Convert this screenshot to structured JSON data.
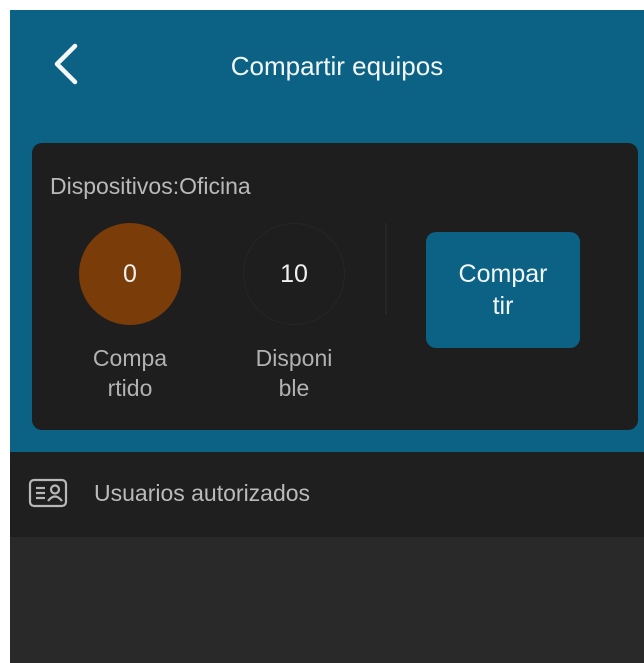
{
  "header": {
    "title": "Compartir equipos",
    "back_icon": "chevron-left-icon"
  },
  "device_card": {
    "title": "Dispositivos:Oficina",
    "shared": {
      "count": "0",
      "label": "Compa\nrtido",
      "color": "#7a3c08"
    },
    "available": {
      "count": "10",
      "label": "Disponi\nble"
    },
    "share_button_label": "Compar\ntir"
  },
  "authorized_users": {
    "icon": "contact-card-icon",
    "label": "Usuarios autorizados"
  },
  "theme": {
    "accent": "#0b6284",
    "background": "#292929",
    "card": "#1e1e1e"
  }
}
